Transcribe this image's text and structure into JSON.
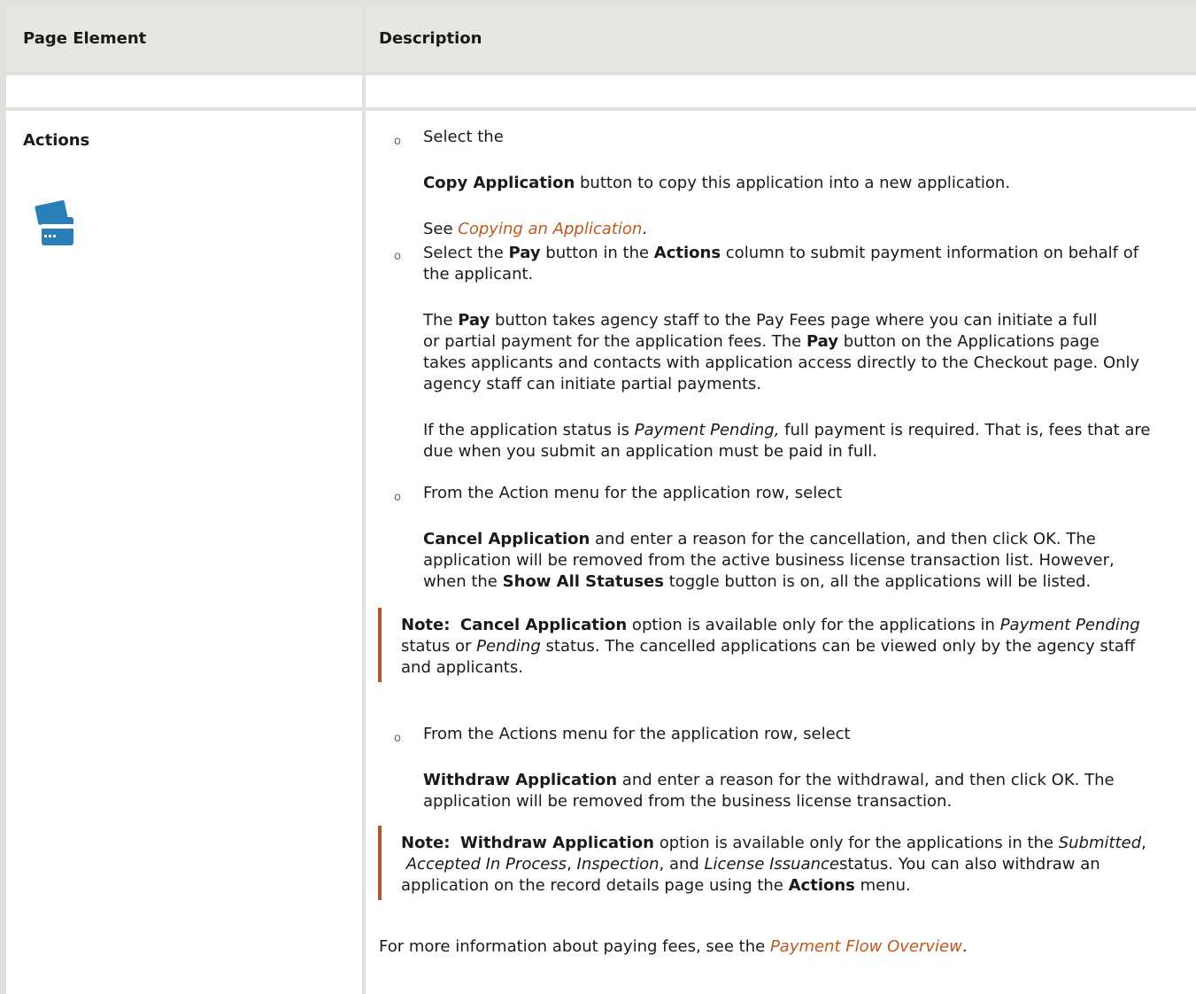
{
  "table": {
    "header": {
      "col1": "Page Element",
      "col2": "Description"
    },
    "row_label": "Actions",
    "icon": "credit-card-icon"
  },
  "item1": {
    "select_the": "Select the",
    "bold": "Copy Application",
    "rest": " button to copy this application into a new application.",
    "see": "See ",
    "link": "Copying an Application",
    "period": "."
  },
  "item2": {
    "l1a": "Select the ",
    "l1b": "Pay",
    "l1c": " button in the ",
    "l1d": "Actions",
    "l1e": " column to submit payment information on behalf of",
    "l2": "the applicant.",
    "p1a": "The ",
    "p1b": "Pay",
    "p1c": " button takes agency staff to the Pay Fees page where you can initiate a full",
    "p2a": "or partial payment for the application fees. The ",
    "p2b": "Pay",
    "p2c": " button on the Applications page",
    "p3": "takes applicants and contacts with application access directly to the Checkout page. Only",
    "p4": "agency staff can initiate partial payments.",
    "s1a": "If the application status is ",
    "s1b": "Payment Pending,",
    "s1c": " full payment is required. That is, fees that are",
    "s2": "due when you submit an application must be paid in full."
  },
  "item3": {
    "l1": "From the Action menu for the application row, select",
    "a1": "Cancel Application",
    "a1b": " and enter a reason for the cancellation, and then click OK. The",
    "a2": "application will be removed from the active business license transaction list. However,",
    "a3a": " when the ",
    "a3b": "Show All Statuses",
    "a3c": " toggle button is on, all the applications will be listed.",
    "n1a": "Note:",
    "n1b": "Cancel Application",
    "n1c": " option is available only for the applications in ",
    "n1d": "Payment Pending",
    "n2a": "status or ",
    "n2b": "Pending",
    "n2c": " status. The cancelled applications can be viewed only by the agency staff",
    "n3": "and applicants."
  },
  "item4": {
    "l1": "From the Actions menu for the application row, select",
    "a1": "Withdraw Application",
    "a1b": " and enter a reason for the withdrawal, and then click OK. The",
    "a2": "application will be removed from the business license transaction.",
    "n1a": "Note:",
    "n1b": "Withdraw Application",
    "n1c": "  option is available only for the applications in the ",
    "n1d": "Submitted",
    "n2a": "Accepted In Process",
    "n2b": "Inspection",
    "n2c": ", and ",
    "n2d": "License Issuance",
    "n2e": "status. You can also withdraw an",
    "n3a": "application on the record details page using the ",
    "n3b": "Actions",
    "n3c": " menu."
  },
  "footer": {
    "text": "For more information about paying fees, see the ",
    "link": "Payment Flow Overview",
    "period": "."
  },
  "bullet_glyph": "o"
}
